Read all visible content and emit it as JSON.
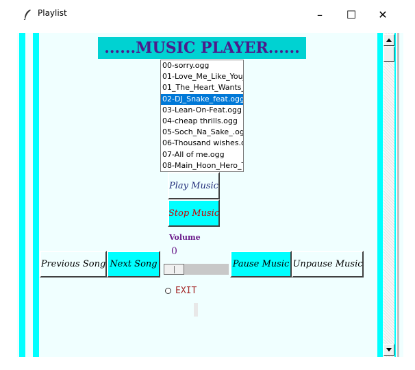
{
  "window": {
    "title": "Playlist",
    "controls": {
      "minimize": "–",
      "maximize": "☐",
      "close": "✕"
    }
  },
  "header": {
    "text": "......MUSIC PLAYER......"
  },
  "playlist": {
    "items": [
      "00-sorry.ogg",
      "01-Love_Me_Like_You_",
      "01_The_Heart_Wants_V",
      "02-DJ_Snake_feat.ogg",
      "03-Lean-On-Feat.ogg",
      "04-cheap thrills.ogg",
      "05-Soch_Na_Sake_.ogg",
      "06-Thousand wishes.o",
      "07-All of me.ogg",
      "08-Main_Hoon_Hero_T"
    ],
    "selected_index": 3
  },
  "buttons": {
    "play": "Play Music",
    "stop": "Stop Music",
    "previous": "Previous Song",
    "next": "Next Song",
    "pause": "Pause Music",
    "unpause": "Unpause Music"
  },
  "volume": {
    "label": "Volume",
    "value": "0",
    "level": 0
  },
  "exit": {
    "label": "EXIT"
  },
  "colors": {
    "accent_cyan": "#00ffff",
    "header_bg": "#00d2d2",
    "header_text": "#4b1c8c",
    "client_bg": "#f0ffff",
    "selection": "#0078d7",
    "stop_text": "#cc0000",
    "volume_text": "#6a1b8a",
    "exit_text": "#a52a2a"
  },
  "icons": {
    "app": "feather-icon",
    "scroll_up": "arrow-up-icon",
    "scroll_down": "arrow-down-icon"
  }
}
